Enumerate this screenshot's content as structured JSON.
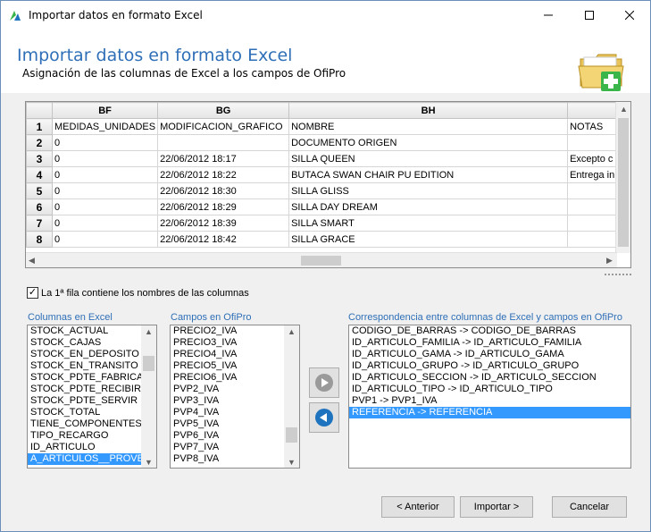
{
  "window": {
    "title": "Importar datos en formato Excel"
  },
  "header": {
    "title": "Importar datos en formato Excel",
    "subtitle": "Asignación de las columnas de Excel a los campos de OfiPro"
  },
  "grid": {
    "columns": [
      "BF",
      "BG",
      "BH"
    ],
    "rows": [
      {
        "n": "1",
        "bf": "MEDIDAS_UNIDADES",
        "bg": "MODIFICACION_GRAFICO",
        "bh": "NOMBRE",
        "bi": "NOTAS"
      },
      {
        "n": "2",
        "bf": "0",
        "bg": "",
        "bh": "DOCUMENTO ORIGEN",
        "bi": ""
      },
      {
        "n": "3",
        "bf": "0",
        "bg": "22/06/2012 18:17",
        "bh": "SILLA QUEEN",
        "bi": "Excepto c"
      },
      {
        "n": "4",
        "bf": "0",
        "bg": "22/06/2012 18:22",
        "bh": "BUTACA SWAN CHAIR PU EDITION",
        "bi": "Entrega in"
      },
      {
        "n": "5",
        "bf": "0",
        "bg": "22/06/2012 18:30",
        "bh": "SILLA GLISS",
        "bi": ""
      },
      {
        "n": "6",
        "bf": "0",
        "bg": "22/06/2012 18:29",
        "bh": "SILLA DAY DREAM",
        "bi": ""
      },
      {
        "n": "7",
        "bf": "0",
        "bg": "22/06/2012 18:39",
        "bh": "SILLA SMART",
        "bi": ""
      },
      {
        "n": "8",
        "bf": "0",
        "bg": "22/06/2012 18:42",
        "bh": "SILLA GRACE",
        "bi": ""
      }
    ]
  },
  "checkbox": {
    "label": "La 1ª fila contiene los nombres de las columnas",
    "checked": true
  },
  "excel_columns": {
    "label": "Columnas en Excel",
    "items": [
      "STOCK_ACTUAL",
      "STOCK_CAJAS",
      "STOCK_EN_DEPOSITO",
      "STOCK_EN_TRANSITO",
      "STOCK_PDTE_FABRICAR",
      "STOCK_PDTE_RECIBIR",
      "STOCK_PDTE_SERVIR",
      "STOCK_TOTAL",
      "TIENE_COMPONENTES",
      "TIPO_RECARGO",
      "ID_ARTICULO",
      "A_ARTICULOS__PROVEE"
    ],
    "selected_index": 11
  },
  "ofipro_fields": {
    "label": "Campos en OfiPro",
    "items": [
      "PRECIO2_IVA",
      "PRECIO3_IVA",
      "PRECIO4_IVA",
      "PRECIO5_IVA",
      "PRECIO6_IVA",
      "PVP2_IVA",
      "PVP3_IVA",
      "PVP4_IVA",
      "PVP5_IVA",
      "PVP6_IVA",
      "PVP7_IVA",
      "PVP8_IVA"
    ]
  },
  "mapping": {
    "label": "Correspondencia entre columnas de Excel y campos en OfiPro",
    "items": [
      "CODIGO_DE_BARRAS -> CODIGO_DE_BARRAS",
      "ID_ARTICULO_FAMILIA -> ID_ARTICULO_FAMILIA",
      "ID_ARTICULO_GAMA -> ID_ARTICULO_GAMA",
      "ID_ARTICULO_GRUPO -> ID_ARTICULO_GRUPO",
      "ID_ARTICULO_SECCION -> ID_ARTICULO_SECCION",
      "ID_ARTICULO_TIPO -> ID_ARTICULO_TIPO",
      "PVP1 -> PVP1_IVA",
      "REFERENCIA -> REFERENCIA"
    ],
    "selected_index": 7
  },
  "buttons": {
    "back": "< Anterior",
    "import": "Importar >",
    "cancel": "Cancelar"
  },
  "colors": {
    "accent": "#2e6fb7",
    "selection": "#3399ff",
    "add_icon": "#3ab54a",
    "remove_icon": "#1e73be"
  },
  "icons": [
    "app-icon",
    "minimize-icon",
    "maximize-icon",
    "close-icon",
    "folder-add-icon",
    "add-mapping-icon",
    "remove-mapping-icon"
  ]
}
